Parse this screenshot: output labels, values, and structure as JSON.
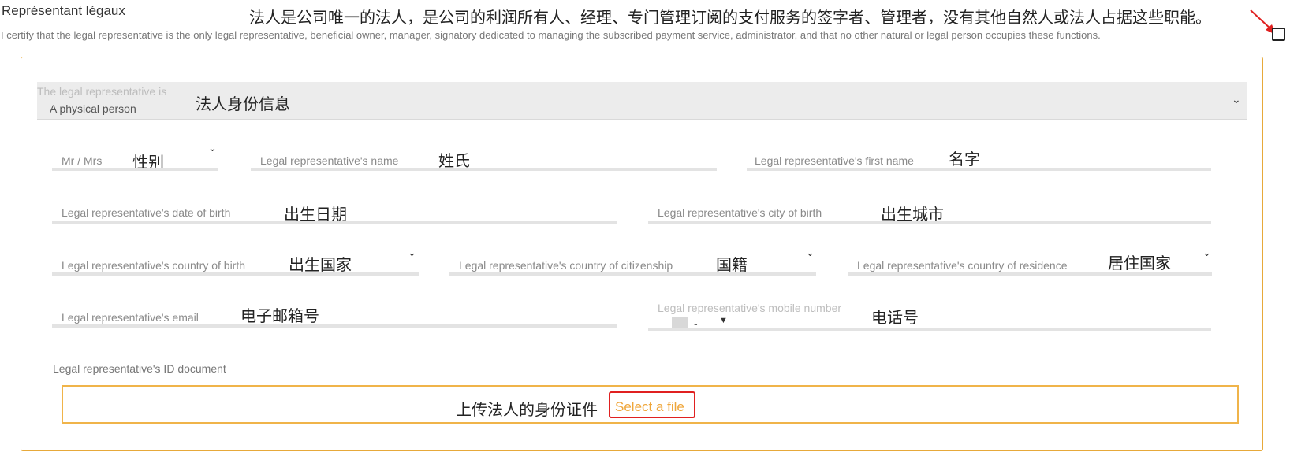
{
  "section": {
    "title": "Représentant légaux",
    "note_cn": "法人是公司唯一的法人，是公司的利润所有人、经理、专门管理订阅的支付服务的签字者、管理者，没有其他自然人或法人占据这些职能。",
    "certify_text": "I certify that the legal representative is the only legal representative, beneficial owner, manager, signatory dedicated to managing the subscribed payment service, administrator, and that no other natural or legal person occupies these functions."
  },
  "annotation_color": "#e02020",
  "accent_color": "#efa63a",
  "rep_type": {
    "label": "The legal representative is",
    "value": "A physical person",
    "note_cn": "法人身份信息"
  },
  "fields": {
    "title": {
      "label": "Mr / Mrs",
      "note_cn": "性别"
    },
    "name": {
      "label": "Legal representative's name",
      "note_cn": "姓氏"
    },
    "first_name": {
      "label": "Legal representative's first name",
      "note_cn": "名字"
    },
    "birth_date": {
      "label": "Legal representative's date of birth",
      "note_cn": "出生日期"
    },
    "birth_city": {
      "label": "Legal representative's city of birth",
      "note_cn": "出生城市"
    },
    "birth_country": {
      "label": "Legal representative's country of birth",
      "note_cn": "出生国家"
    },
    "citizenship": {
      "label": "Legal representative's country of citizenship",
      "note_cn": "国籍"
    },
    "residence": {
      "label": "Legal representative's country of residence",
      "note_cn": "居住国家"
    },
    "email": {
      "label": "Legal representative's email",
      "note_cn": "电子邮箱号"
    },
    "mobile": {
      "label": "Legal representative's mobile number",
      "dial_code": "-",
      "note_cn": "电话号"
    }
  },
  "id_document": {
    "label": "Legal representative's ID document",
    "note_cn": "上传法人的身份证件",
    "select_label": "Select a file"
  },
  "icons": {
    "chevron": "chevron-down-icon",
    "arrow": "red-annotation-arrow",
    "flag": "flag-placeholder-icon"
  }
}
